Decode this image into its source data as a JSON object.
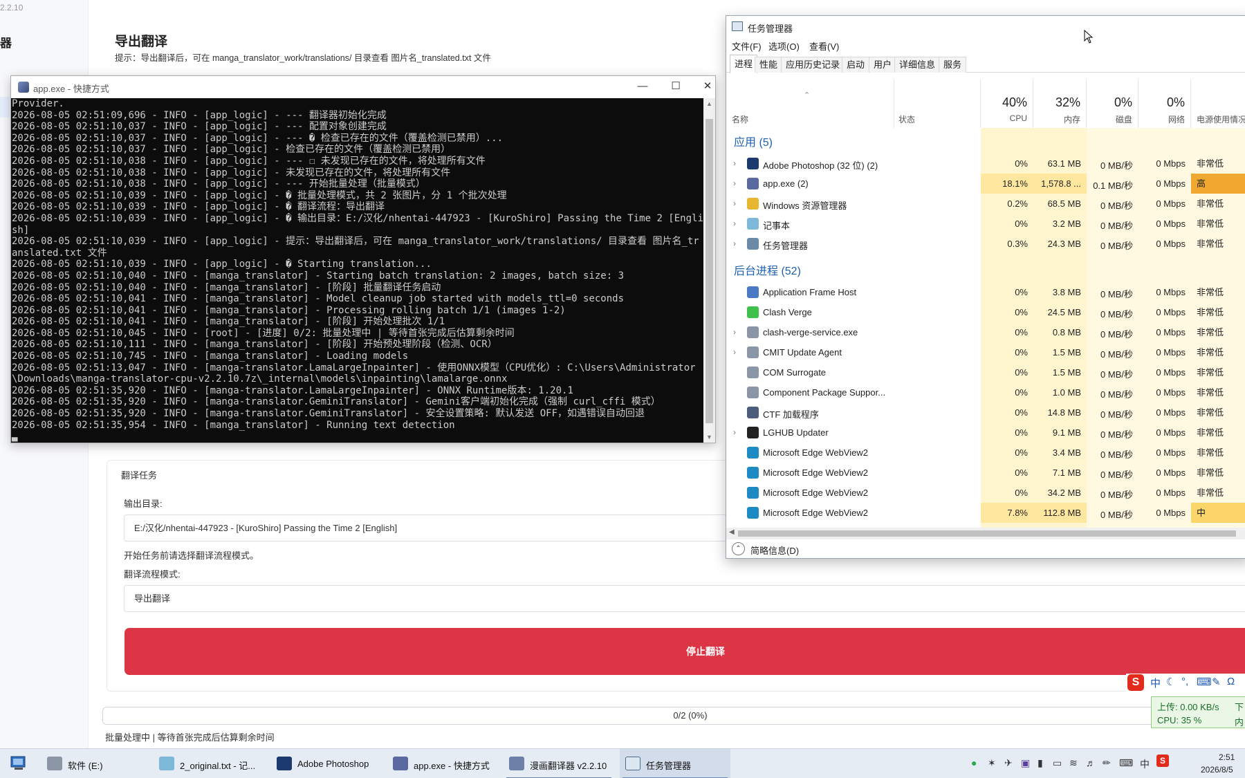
{
  "background_app": {
    "version": "2.2.10",
    "sidebar_logo": "器",
    "export_title": "导出翻译",
    "export_hint": "提示：导出翻译后，可在 manga_translator_work/translations/ 目录查看 图片名_translated.txt 文件",
    "task_section_title": "翻译任务",
    "output_dir_label": "输出目录:",
    "output_dir_value": "E:/汉化/nhentai-447923 - [KuroShiro] Passing the Time 2 [English]",
    "flow_notice": "开始任务前请选择翻译流程模式。",
    "flow_mode_label": "翻译流程模式:",
    "flow_mode_value": "导出翻译",
    "stop_button": "停止翻译",
    "progress_text": "0/2 (0%)",
    "progress_fraction": 0,
    "status_text": "批量处理中 | 等待首张完成后估算剩余时间"
  },
  "console": {
    "title": "app.exe - 快捷方式",
    "text": "Provider.\n2026-08-05 02:51:09,696 - INFO - [app_logic] - --- 翻译器初始化完成\n2026-08-05 02:51:10,037 - INFO - [app_logic] - --- 配置对象创建完成\n2026-08-05 02:51:10,037 - INFO - [app_logic] - --- � 检查已存在的文件（覆盖检测已禁用）...\n2026-08-05 02:51:10,037 - INFO - [app_logic] - 检查已存在的文件（覆盖检测已禁用）\n2026-08-05 02:51:10,038 - INFO - [app_logic] - --- ☐ 未发现已存在的文件，将处理所有文件\n2026-08-05 02:51:10,038 - INFO - [app_logic] - 未发现已存在的文件，将处理所有文件\n2026-08-05 02:51:10,038 - INFO - [app_logic] - --- 开始批量处理（批量模式）\n2026-08-05 02:51:10,039 - INFO - [app_logic] - � 批量处理模式，共 2 张图片，分 1 个批次处理\n2026-08-05 02:51:10,039 - INFO - [app_logic] - � 翻译流程：导出翻译\n2026-08-05 02:51:10,039 - INFO - [app_logic] - � 输出目录：E:/汉化/nhentai-447923 - [KuroShiro] Passing the Time 2 [English]\n2026-08-05 02:51:10,039 - INFO - [app_logic] - 提示：导出翻译后，可在 manga_translator_work/translations/ 目录查看 图片名_translated.txt 文件\n2026-08-05 02:51:10,039 - INFO - [app_logic] - � Starting translation...\n2026-08-05 02:51:10,040 - INFO - [manga_translator] - Starting batch translation: 2 images, batch size: 3\n2026-08-05 02:51:10,040 - INFO - [manga_translator] - [阶段] 批量翻译任务启动\n2026-08-05 02:51:10,041 - INFO - [manga_translator] - Model cleanup job started with models_ttl=0 seconds\n2026-08-05 02:51:10,041 - INFO - [manga_translator] - Processing rolling batch 1/1 (images 1-2)\n2026-08-05 02:51:10,041 - INFO - [manga_translator] - [阶段] 开始处理批次 1/1\n2026-08-05 02:51:10,045 - INFO - [root] - [进度] 0/2: 批量处理中 | 等待首张完成后估算剩余时间\n2026-08-05 02:51:10,111 - INFO - [manga_translator] - [阶段] 开始预处理阶段（检测、OCR）\n2026-08-05 02:51:10,745 - INFO - [manga_translator] - Loading models\n2026-08-05 02:51:13,047 - INFO - [manga-translator.LamaLargeInpainter] - 使用ONNX模型（CPU优化）: C:\\Users\\Administrator\\Downloads\\manga-translator-cpu-v2.2.10.7z\\_internal\\models\\inpainting\\lamalarge.onnx\n2026-08-05 02:51:35,920 - INFO - [manga-translator.LamaLargeInpainter] - ONNX Runtime版本: 1.20.1\n2026-08-05 02:51:35,920 - INFO - [manga-translator.GeminiTranslator] - Gemini客户端初始化完成（强制 curl_cffi 模式）\n2026-08-05 02:51:35,920 - INFO - [manga-translator.GeminiTranslator] - 安全设置策略: 默认发送 OFF，如遇错误自动回退\n2026-08-05 02:51:35,954 - INFO - [manga_translator] - Running text detection\n▃"
  },
  "task_manager": {
    "title": "任务管理器",
    "menu": [
      "文件(F)",
      "选项(O)",
      "查看(V)"
    ],
    "tabs": [
      "进程",
      "性能",
      "应用历史记录",
      "启动",
      "用户",
      "详细信息",
      "服务"
    ],
    "columns": {
      "name": "名称",
      "status": "状态",
      "cpu_pct": "40%",
      "cpu": "CPU",
      "mem_pct": "32%",
      "mem": "内存",
      "disk_pct": "0%",
      "disk": "磁盘",
      "net_pct": "0%",
      "net": "网络",
      "power": "电源使用情况"
    },
    "group_apps": "应用 (5)",
    "group_bg": "后台进程 (52)",
    "apps": [
      {
        "name": "Adobe Photoshop (32 位) (2)",
        "cpu": "0%",
        "mem": "63.1 MB",
        "disk": "0 MB/秒",
        "net": "0 Mbps",
        "power": "非常低",
        "icon": "photoshop-icon"
      },
      {
        "name": "app.exe (2)",
        "cpu": "18.1%",
        "mem": "1,578.8 ...",
        "disk": "0.1 MB/秒",
        "net": "0 Mbps",
        "power": "高",
        "icon": "app-exe-icon"
      },
      {
        "name": "Windows 资源管理器",
        "cpu": "0.2%",
        "mem": "68.5 MB",
        "disk": "0 MB/秒",
        "net": "0 Mbps",
        "power": "非常低",
        "icon": "folder-icon"
      },
      {
        "name": "记事本",
        "cpu": "0%",
        "mem": "3.2 MB",
        "disk": "0 MB/秒",
        "net": "0 Mbps",
        "power": "非常低",
        "icon": "notepad-icon"
      },
      {
        "name": "任务管理器",
        "cpu": "0.3%",
        "mem": "24.3 MB",
        "disk": "0 MB/秒",
        "net": "0 Mbps",
        "power": "非常低",
        "icon": "taskmgr-icon"
      }
    ],
    "background": [
      {
        "name": "Application Frame Host",
        "cpu": "0%",
        "mem": "3.8 MB",
        "disk": "0 MB/秒",
        "net": "0 Mbps",
        "power": "非常低",
        "icon": "app-frame-icon",
        "expand": false
      },
      {
        "name": "Clash Verge",
        "cpu": "0%",
        "mem": "24.5 MB",
        "disk": "0 MB/秒",
        "net": "0 Mbps",
        "power": "非常低",
        "icon": "clash-icon",
        "expand": false
      },
      {
        "name": "clash-verge-service.exe",
        "cpu": "0%",
        "mem": "0.8 MB",
        "disk": "0 MB/秒",
        "net": "0 Mbps",
        "power": "非常低",
        "icon": "service-icon",
        "expand": true
      },
      {
        "name": "CMIT Update Agent",
        "cpu": "0%",
        "mem": "1.5 MB",
        "disk": "0 MB/秒",
        "net": "0 Mbps",
        "power": "非常低",
        "icon": "service-icon",
        "expand": true
      },
      {
        "name": "COM Surrogate",
        "cpu": "0%",
        "mem": "1.5 MB",
        "disk": "0 MB/秒",
        "net": "0 Mbps",
        "power": "非常低",
        "icon": "service-icon",
        "expand": false
      },
      {
        "name": "Component Package Suppor...",
        "cpu": "0%",
        "mem": "1.0 MB",
        "disk": "0 MB/秒",
        "net": "0 Mbps",
        "power": "非常低",
        "icon": "service-icon",
        "expand": false
      },
      {
        "name": "CTF 加载程序",
        "cpu": "0%",
        "mem": "14.8 MB",
        "disk": "0 MB/秒",
        "net": "0 Mbps",
        "power": "非常低",
        "icon": "ctf-icon",
        "expand": false
      },
      {
        "name": "LGHUB Updater",
        "cpu": "0%",
        "mem": "9.1 MB",
        "disk": "0 MB/秒",
        "net": "0 Mbps",
        "power": "非常低",
        "icon": "lghub-icon",
        "expand": true
      },
      {
        "name": "Microsoft Edge WebView2",
        "cpu": "0%",
        "mem": "3.4 MB",
        "disk": "0 MB/秒",
        "net": "0 Mbps",
        "power": "非常低",
        "icon": "webview-icon",
        "expand": false
      },
      {
        "name": "Microsoft Edge WebView2",
        "cpu": "0%",
        "mem": "7.1 MB",
        "disk": "0 MB/秒",
        "net": "0 Mbps",
        "power": "非常低",
        "icon": "webview-icon",
        "expand": false
      },
      {
        "name": "Microsoft Edge WebView2",
        "cpu": "0%",
        "mem": "34.2 MB",
        "disk": "0 MB/秒",
        "net": "0 Mbps",
        "power": "非常低",
        "icon": "webview-icon",
        "expand": false
      },
      {
        "name": "Microsoft Edge WebView2",
        "cpu": "7.8%",
        "mem": "112.8 MB",
        "disk": "0 MB/秒",
        "net": "0 Mbps",
        "power": "中",
        "icon": "webview-icon",
        "expand": false
      }
    ],
    "fewer_details": "简略信息(D)"
  },
  "ime": {
    "mode": "中"
  },
  "net_widget": {
    "upload": "上传: 0.00 KB/s",
    "cpu": "CPU: 35 %",
    "download": "下",
    "mem": "内"
  },
  "taskbar": {
    "items": [
      {
        "label": "软件 (E:)",
        "icon": "drive-icon"
      },
      {
        "label": "2_original.txt - 记...",
        "icon": "notepad-icon"
      },
      {
        "label": "Adobe Photoshop",
        "icon": "photoshop-icon"
      },
      {
        "label": "app.exe - 快捷方式",
        "icon": "app-exe-icon"
      },
      {
        "label": "漫画翻译器 v2.2.10",
        "icon": "manga-translator-icon"
      },
      {
        "label": "任务管理器",
        "icon": "taskmgr-icon"
      }
    ],
    "ime_lang": "中",
    "time": "2:51",
    "date": "2026/8/5"
  },
  "colors": {
    "stop_button": "#dc3545",
    "cpu_highlight": "#fff3c4",
    "power_high": "#f0a830",
    "group_text": "#1c5fb0"
  }
}
